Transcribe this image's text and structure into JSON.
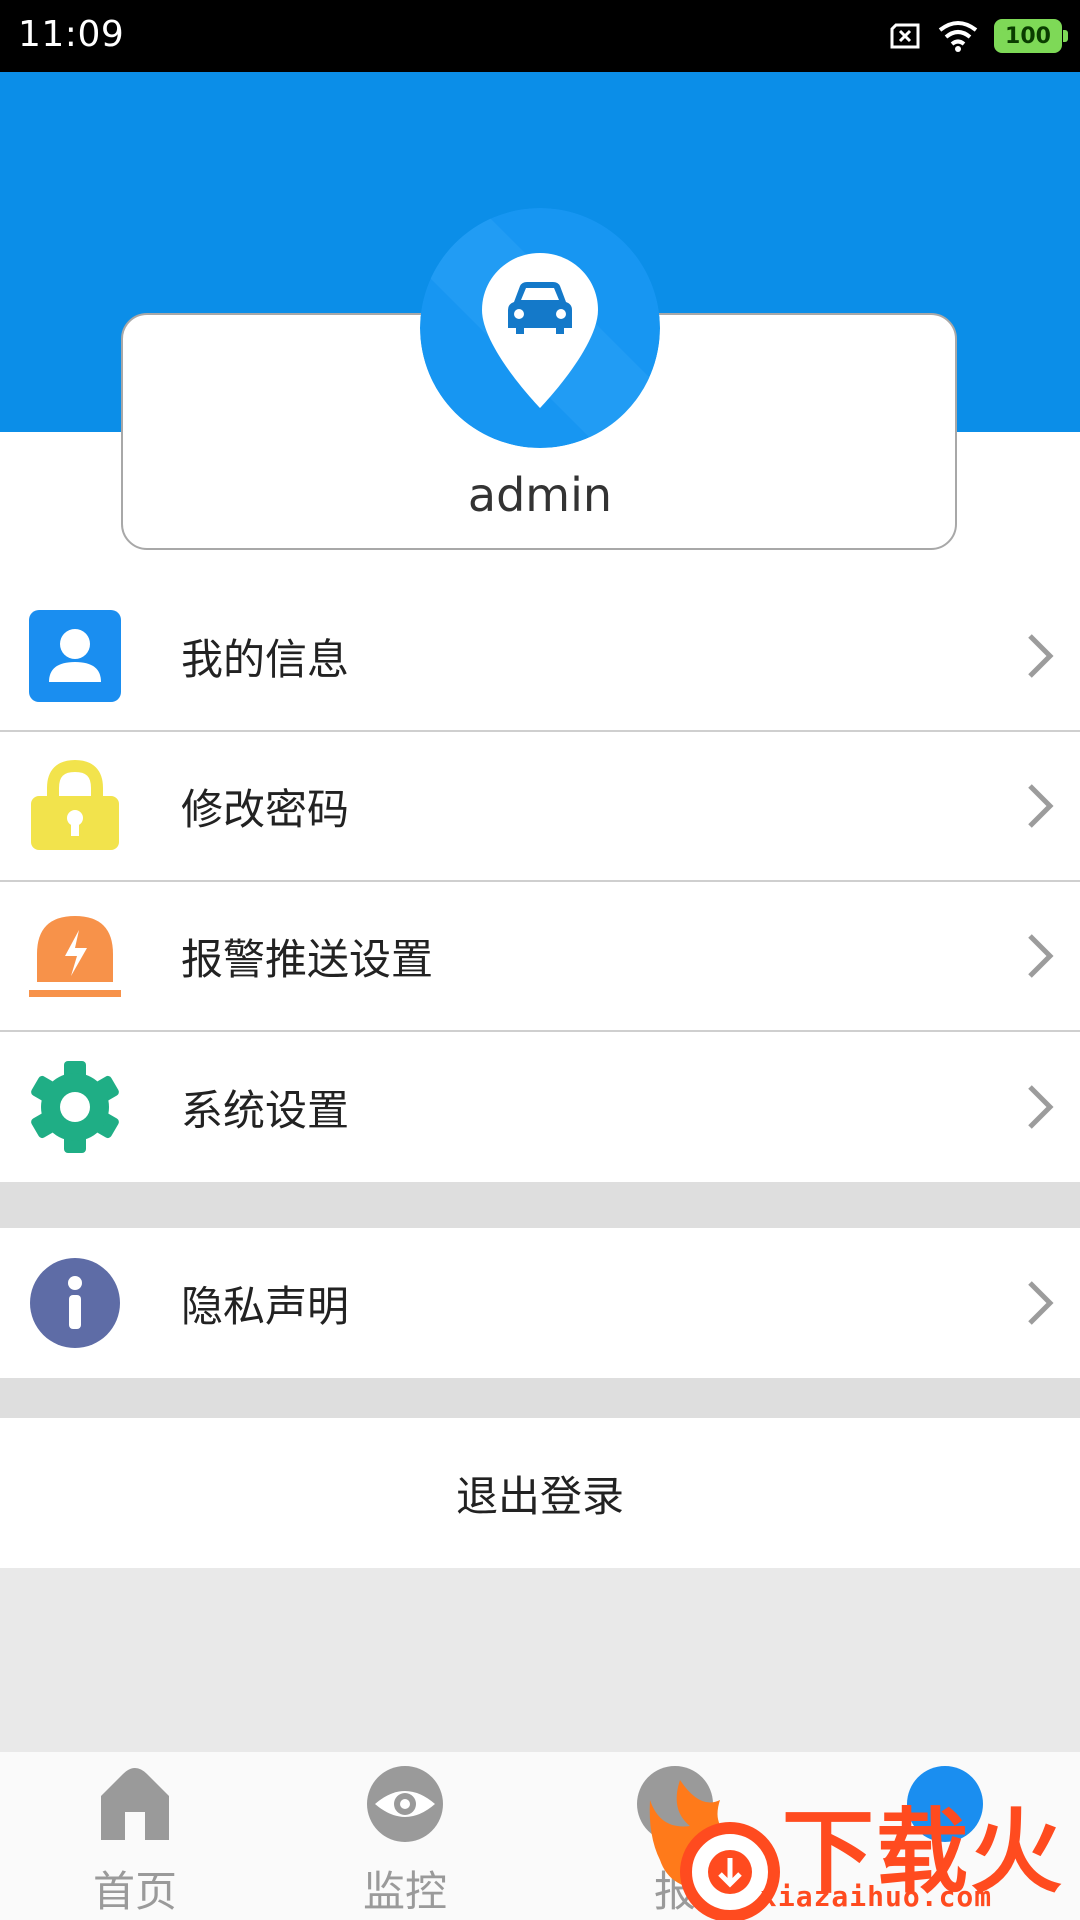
{
  "status_bar": {
    "time": "11:09",
    "battery": "100"
  },
  "profile": {
    "username": "admin",
    "avatar_icon": "car-location-pin-icon"
  },
  "menu": {
    "items": [
      {
        "label": "我的信息",
        "icon": "user-icon",
        "color": "#1a8ef0"
      },
      {
        "label": "修改密码",
        "icon": "lock-icon",
        "color": "#f2e34c"
      },
      {
        "label": "报警推送设置",
        "icon": "alarm-light-icon",
        "color": "#f7924a"
      },
      {
        "label": "系统设置",
        "icon": "gear-icon",
        "color": "#1fae85"
      }
    ],
    "privacy": {
      "label": "隐私声明",
      "icon": "info-icon",
      "color": "#5e6ca6"
    }
  },
  "logout_label": "退出登录",
  "bottom_nav": {
    "items": [
      {
        "label": "首页",
        "icon": "home-icon"
      },
      {
        "label": "监控",
        "icon": "eye-icon"
      },
      {
        "label": "报",
        "icon": "alert-icon"
      },
      {
        "label": "",
        "icon": "user-tab-icon"
      }
    ]
  },
  "watermark": {
    "text": "下载火",
    "url": "xiazaihuo.com"
  },
  "colors": {
    "header_blue": "#0b8ee8",
    "background": "#e9e9e9"
  }
}
